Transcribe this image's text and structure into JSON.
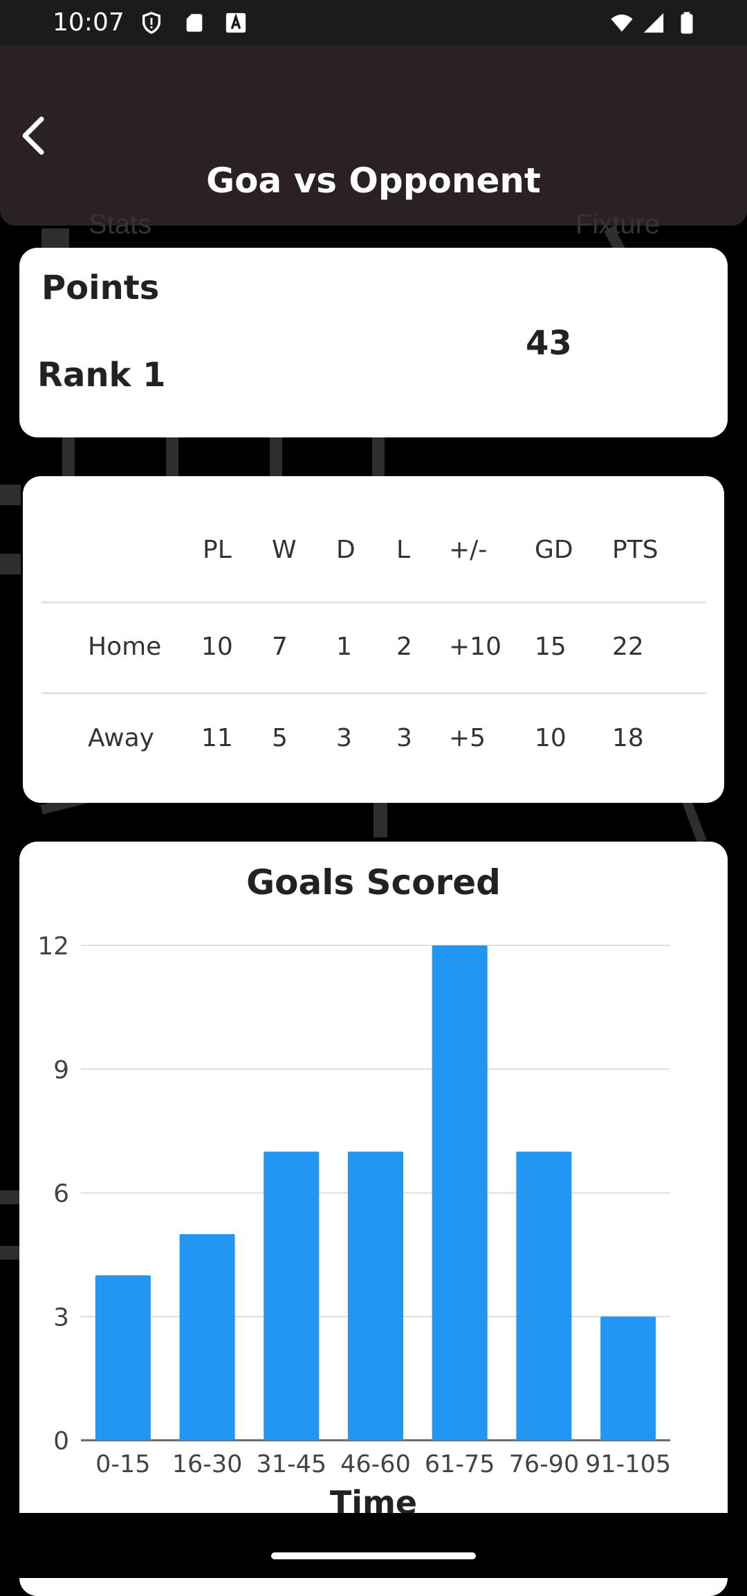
{
  "status_bar": {
    "time": "10:07",
    "icons": [
      "shield-icon",
      "sd-card-icon",
      "font-a-icon",
      "wifi-icon",
      "signal-icon",
      "battery-icon"
    ]
  },
  "app_bar": {
    "title": "Goa vs Opponent",
    "back_icon": "chevron-left-icon",
    "ghost_tabs": [
      "Stats",
      "Fixture"
    ]
  },
  "points_card": {
    "label": "Points",
    "value": "43",
    "rank": "Rank 1"
  },
  "stats_table": {
    "headers": [
      "",
      "PL",
      "W",
      "D",
      "L",
      "+/-",
      "GD",
      "PTS"
    ],
    "rows": [
      [
        "Home",
        "10",
        "7",
        "1",
        "2",
        "+10",
        "15",
        "22"
      ],
      [
        "Away",
        "11",
        "5",
        "3",
        "3",
        "+5",
        "10",
        "18"
      ]
    ]
  },
  "chart_data": {
    "type": "bar",
    "title": "Goals Scored",
    "xlabel": "Time",
    "ylabel": "",
    "categories": [
      "0-15",
      "16-30",
      "31-45",
      "46-60",
      "61-75",
      "76-90",
      "91-105"
    ],
    "values": [
      4,
      5,
      7,
      7,
      12,
      7,
      3
    ],
    "ylim": [
      0,
      12
    ],
    "yticks": [
      0,
      3,
      6,
      9,
      12
    ],
    "grid": true,
    "bar_color": "#2196F3"
  },
  "colors": {
    "app_bar": "#2a2222",
    "bar": "#2196F3",
    "background": "#000000",
    "card": "#ffffff"
  }
}
